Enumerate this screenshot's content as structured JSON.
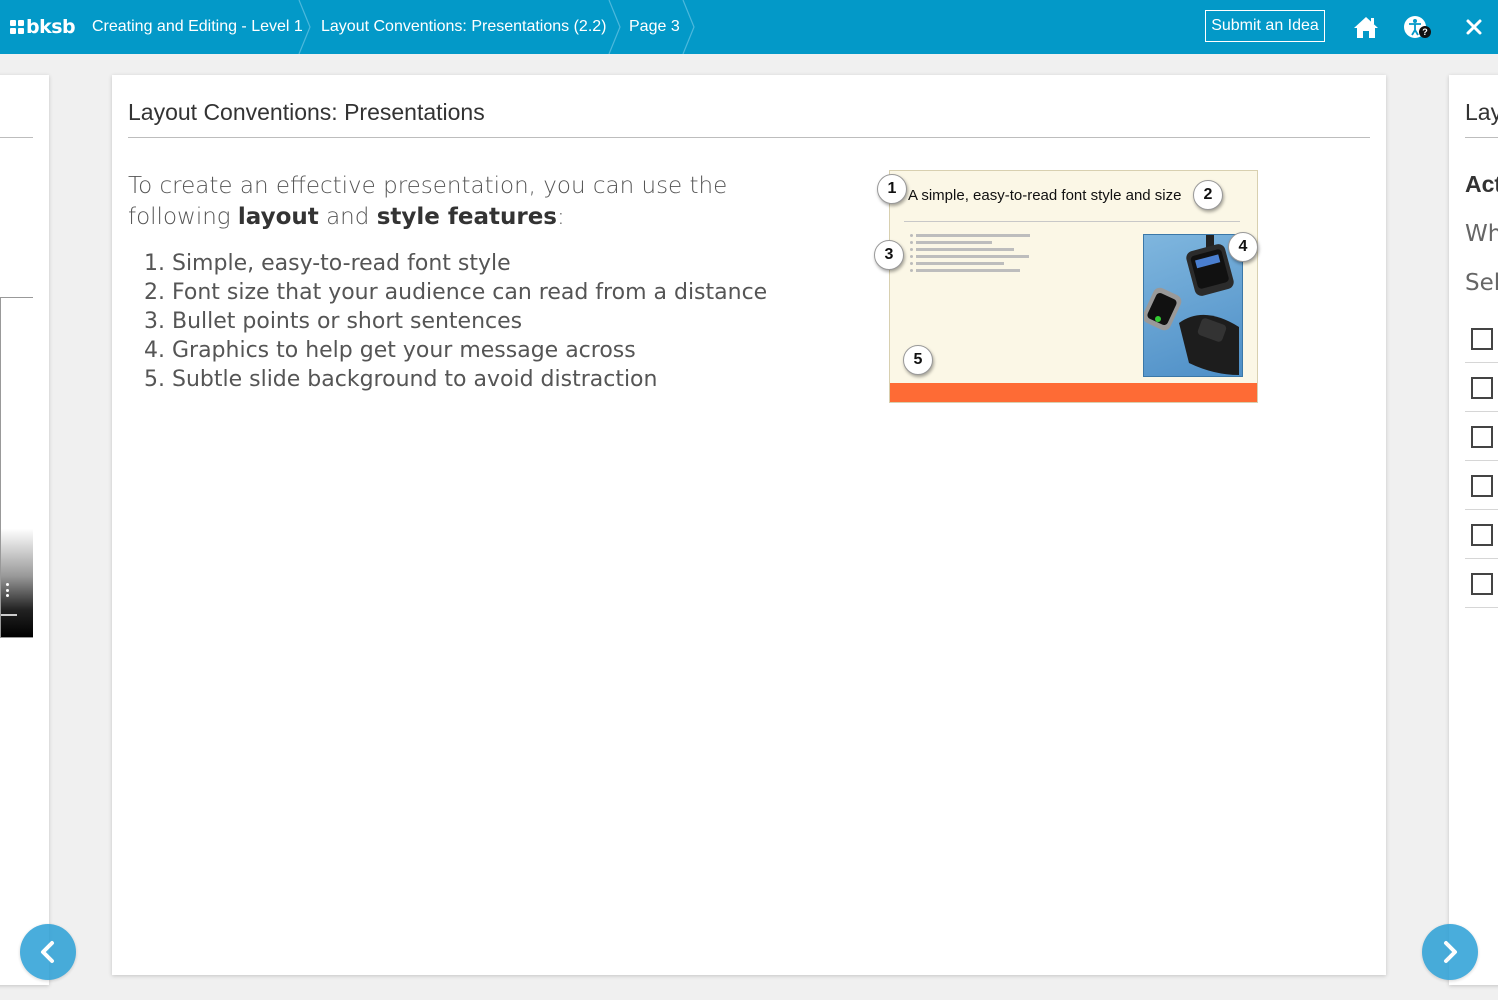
{
  "topbar": {
    "logo_text": "bksb",
    "breadcrumbs": [
      {
        "label": "Creating and Editing - Level 1"
      },
      {
        "label": "Layout Conventions: Presentations (2.2)"
      },
      {
        "label": "Page 3"
      }
    ],
    "submit_label": "Submit an Idea",
    "icons": [
      "home-icon",
      "accessibility-icon",
      "help-badge-icon",
      "close-icon"
    ],
    "help_badge": "?",
    "colors": {
      "bar": "#0399c8"
    }
  },
  "main": {
    "title": "Layout Conventions: Presentations",
    "intro_line1": "To create an effective presentation, you can use the",
    "intro_line2_prefix": "following ",
    "intro_bold1": "layout",
    "intro_and": " and ",
    "intro_bold2": "style features",
    "intro_colon": ":",
    "features": [
      "1. Simple, easy-to-read font style",
      "2. Font size that your audience can read from a distance",
      "3. Bullet points or short sentences",
      "4. Graphics to help get your message across",
      "5. Subtle slide background to avoid distraction"
    ],
    "slide": {
      "title": "A simple, easy-to-read font style and size",
      "badges": [
        "1",
        "2",
        "3",
        "4",
        "5"
      ],
      "image_alt": "smartwatches-image",
      "colors": {
        "background": "#fbf7e6",
        "footer": "#fe6b35"
      }
    }
  },
  "right_card": {
    "title": "Lay",
    "heading": "Act",
    "text1": "Wh",
    "text2": "Sel",
    "checkbox_count": 6
  },
  "nav": {
    "prev": "chevron-left-icon",
    "next": "chevron-right-icon"
  }
}
